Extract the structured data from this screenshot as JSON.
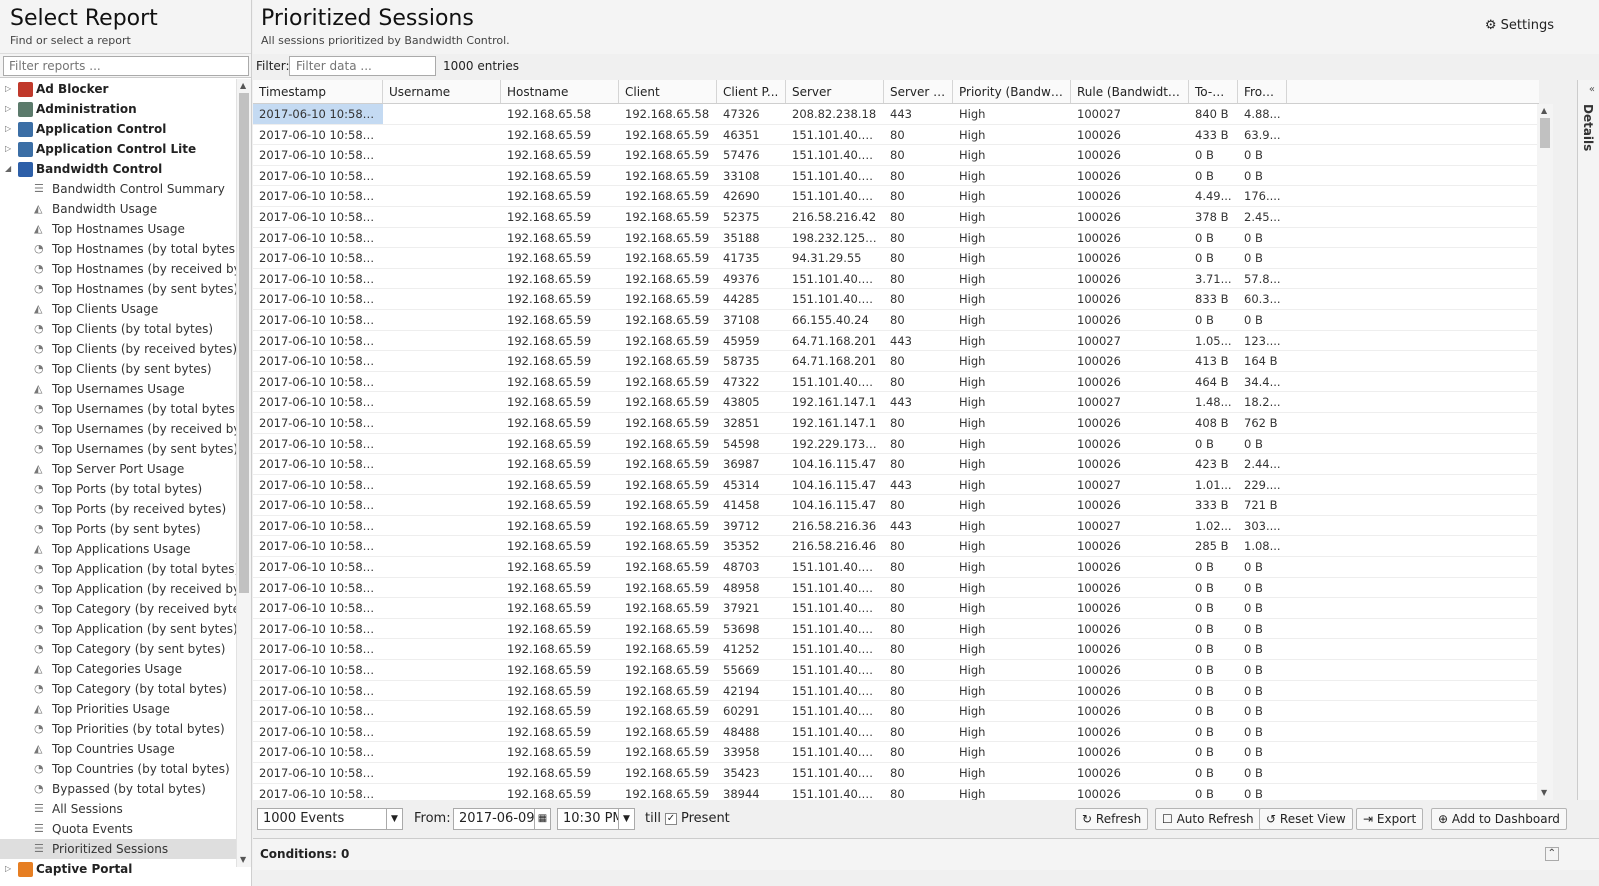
{
  "left": {
    "title": "Select Report",
    "subtitle": "Find or select a report",
    "filter_placeholder": "Filter reports ...",
    "categories": [
      {
        "label": "Ad Blocker",
        "expanded": false,
        "icon_color": "#c0392b"
      },
      {
        "label": "Administration",
        "expanded": false,
        "icon_color": "#5b7a6b"
      },
      {
        "label": "Application Control",
        "expanded": false,
        "icon_color": "#3b6ea5"
      },
      {
        "label": "Application Control Lite",
        "expanded": false,
        "icon_color": "#3b6ea5"
      },
      {
        "label": "Bandwidth Control",
        "expanded": true,
        "icon_color": "#2d5fa8"
      }
    ],
    "reports": [
      {
        "label": "Bandwidth Control Summary",
        "icon": "list-icon"
      },
      {
        "label": "Bandwidth Usage",
        "icon": "area-chart-icon"
      },
      {
        "label": "Top Hostnames Usage",
        "icon": "area-chart-icon"
      },
      {
        "label": "Top Hostnames (by total bytes)",
        "icon": "pie-chart-icon"
      },
      {
        "label": "Top Hostnames (by received byte...",
        "icon": "pie-chart-icon"
      },
      {
        "label": "Top Hostnames (by sent bytes)",
        "icon": "pie-chart-icon"
      },
      {
        "label": "Top Clients Usage",
        "icon": "area-chart-icon"
      },
      {
        "label": "Top Clients (by total bytes)",
        "icon": "pie-chart-icon"
      },
      {
        "label": "Top Clients (by received bytes)",
        "icon": "pie-chart-icon"
      },
      {
        "label": "Top Clients (by sent bytes)",
        "icon": "pie-chart-icon"
      },
      {
        "label": "Top Usernames Usage",
        "icon": "area-chart-icon"
      },
      {
        "label": "Top Usernames (by total bytes)",
        "icon": "pie-chart-icon"
      },
      {
        "label": "Top Usernames (by received bytes)",
        "icon": "pie-chart-icon"
      },
      {
        "label": "Top Usernames (by sent bytes)",
        "icon": "pie-chart-icon"
      },
      {
        "label": "Top Server Port Usage",
        "icon": "area-chart-icon"
      },
      {
        "label": "Top Ports (by total bytes)",
        "icon": "pie-chart-icon"
      },
      {
        "label": "Top Ports (by received bytes)",
        "icon": "pie-chart-icon"
      },
      {
        "label": "Top Ports (by sent bytes)",
        "icon": "pie-chart-icon"
      },
      {
        "label": "Top Applications Usage",
        "icon": "area-chart-icon"
      },
      {
        "label": "Top Application (by total bytes)",
        "icon": "pie-chart-icon"
      },
      {
        "label": "Top Application (by received bytes)",
        "icon": "pie-chart-icon"
      },
      {
        "label": "Top Category (by received bytes)",
        "icon": "pie-chart-icon"
      },
      {
        "label": "Top Application (by sent bytes)",
        "icon": "pie-chart-icon"
      },
      {
        "label": "Top Category (by sent bytes)",
        "icon": "pie-chart-icon"
      },
      {
        "label": "Top Categories Usage",
        "icon": "area-chart-icon"
      },
      {
        "label": "Top Category (by total bytes)",
        "icon": "pie-chart-icon"
      },
      {
        "label": "Top Priorities Usage",
        "icon": "area-chart-icon"
      },
      {
        "label": "Top Priorities (by total bytes)",
        "icon": "pie-chart-icon"
      },
      {
        "label": "Top Countries Usage",
        "icon": "area-chart-icon"
      },
      {
        "label": "Top Countries (by total bytes)",
        "icon": "pie-chart-icon"
      },
      {
        "label": "Bypassed (by total bytes)",
        "icon": "pie-chart-icon"
      },
      {
        "label": "All Sessions",
        "icon": "list-icon"
      },
      {
        "label": "Quota Events",
        "icon": "list-icon"
      },
      {
        "label": "Prioritized Sessions",
        "icon": "list-icon",
        "selected": true
      }
    ],
    "after_category": {
      "label": "Captive Portal",
      "expanded": false,
      "icon_color": "#e67e22"
    }
  },
  "main": {
    "title": "Prioritized Sessions",
    "subtitle": "All sessions prioritized by Bandwidth Control.",
    "settings_label": "Settings",
    "filter_label": "Filter:",
    "filter_placeholder": "Filter data ...",
    "entries_count": "1000 entries",
    "details_label": "Details"
  },
  "grid": {
    "columns": [
      "Timestamp",
      "Username",
      "Hostname",
      "Client",
      "Client P...",
      "Server",
      "Server P...",
      "Priority (Bandwid...",
      "Rule (Bandwidth ...",
      "To-S...",
      "From..."
    ],
    "rows": [
      [
        "2017-06-10 10:58:4...",
        "",
        "192.168.65.58",
        "192.168.65.58",
        "47326",
        "208.82.238.18",
        "443",
        "High",
        "100027",
        "840 B",
        "4.88..."
      ],
      [
        "2017-06-10 10:58:4...",
        "",
        "192.168.65.59",
        "192.168.65.59",
        "46351",
        "151.101.40.1...",
        "80",
        "High",
        "100026",
        "433 B",
        "63.9..."
      ],
      [
        "2017-06-10 10:58:4...",
        "",
        "192.168.65.59",
        "192.168.65.59",
        "57476",
        "151.101.40.1...",
        "80",
        "High",
        "100026",
        "0 B",
        "0 B"
      ],
      [
        "2017-06-10 10:58:4...",
        "",
        "192.168.65.59",
        "192.168.65.59",
        "33108",
        "151.101.40.1...",
        "80",
        "High",
        "100026",
        "0 B",
        "0 B"
      ],
      [
        "2017-06-10 10:58:3...",
        "",
        "192.168.65.59",
        "192.168.65.59",
        "42690",
        "151.101.40.1...",
        "80",
        "High",
        "100026",
        "4.49...",
        "176...."
      ],
      [
        "2017-06-10 10:58:3...",
        "",
        "192.168.65.59",
        "192.168.65.59",
        "52375",
        "216.58.216.42",
        "80",
        "High",
        "100026",
        "378 B",
        "2.45..."
      ],
      [
        "2017-06-10 10:58:3...",
        "",
        "192.168.65.59",
        "192.168.65.59",
        "35188",
        "198.232.125....",
        "80",
        "High",
        "100026",
        "0 B",
        "0 B"
      ],
      [
        "2017-06-10 10:58:3...",
        "",
        "192.168.65.59",
        "192.168.65.59",
        "41735",
        "94.31.29.55",
        "80",
        "High",
        "100026",
        "0 B",
        "0 B"
      ],
      [
        "2017-06-10 10:58:3...",
        "",
        "192.168.65.59",
        "192.168.65.59",
        "49376",
        "151.101.40.1...",
        "80",
        "High",
        "100026",
        "3.71...",
        "57.8..."
      ],
      [
        "2017-06-10 10:58:3...",
        "",
        "192.168.65.59",
        "192.168.65.59",
        "44285",
        "151.101.40.1...",
        "80",
        "High",
        "100026",
        "833 B",
        "60.3..."
      ],
      [
        "2017-06-10 10:58:3...",
        "",
        "192.168.65.59",
        "192.168.65.59",
        "37108",
        "66.155.40.24",
        "80",
        "High",
        "100026",
        "0 B",
        "0 B"
      ],
      [
        "2017-06-10 10:58:3...",
        "",
        "192.168.65.59",
        "192.168.65.59",
        "45959",
        "64.71.168.201",
        "443",
        "High",
        "100027",
        "1.05...",
        "123...."
      ],
      [
        "2017-06-10 10:58:3...",
        "",
        "192.168.65.59",
        "192.168.65.59",
        "58735",
        "64.71.168.201",
        "80",
        "High",
        "100026",
        "413 B",
        "164 B"
      ],
      [
        "2017-06-10 10:58:3...",
        "",
        "192.168.65.59",
        "192.168.65.59",
        "47322",
        "151.101.40.1...",
        "80",
        "High",
        "100026",
        "464 B",
        "34.4..."
      ],
      [
        "2017-06-10 10:58:3...",
        "",
        "192.168.65.59",
        "192.168.65.59",
        "43805",
        "192.161.147.1",
        "443",
        "High",
        "100027",
        "1.48...",
        "18.2..."
      ],
      [
        "2017-06-10 10:58:3...",
        "",
        "192.168.65.59",
        "192.168.65.59",
        "32851",
        "192.161.147.1",
        "80",
        "High",
        "100026",
        "408 B",
        "762 B"
      ],
      [
        "2017-06-10 10:58:3...",
        "",
        "192.168.65.59",
        "192.168.65.59",
        "54598",
        "192.229.173....",
        "80",
        "High",
        "100026",
        "0 B",
        "0 B"
      ],
      [
        "2017-06-10 10:58:3...",
        "",
        "192.168.65.59",
        "192.168.65.59",
        "36987",
        "104.16.115.47",
        "80",
        "High",
        "100026",
        "423 B",
        "2.44..."
      ],
      [
        "2017-06-10 10:58:3...",
        "",
        "192.168.65.59",
        "192.168.65.59",
        "45314",
        "104.16.115.47",
        "443",
        "High",
        "100027",
        "1.01...",
        "229...."
      ],
      [
        "2017-06-10 10:58:3...",
        "",
        "192.168.65.59",
        "192.168.65.59",
        "41458",
        "104.16.115.47",
        "80",
        "High",
        "100026",
        "333 B",
        "721 B"
      ],
      [
        "2017-06-10 10:58:3...",
        "",
        "192.168.65.59",
        "192.168.65.59",
        "39712",
        "216.58.216.36",
        "443",
        "High",
        "100027",
        "1.02...",
        "303...."
      ],
      [
        "2017-06-10 10:58:3...",
        "",
        "192.168.65.59",
        "192.168.65.59",
        "35352",
        "216.58.216.46",
        "80",
        "High",
        "100026",
        "285 B",
        "1.08..."
      ],
      [
        "2017-06-10 10:58:3...",
        "",
        "192.168.65.59",
        "192.168.65.59",
        "48703",
        "151.101.40.1...",
        "80",
        "High",
        "100026",
        "0 B",
        "0 B"
      ],
      [
        "2017-06-10 10:58:3...",
        "",
        "192.168.65.59",
        "192.168.65.59",
        "48958",
        "151.101.40.1...",
        "80",
        "High",
        "100026",
        "0 B",
        "0 B"
      ],
      [
        "2017-06-10 10:58:3...",
        "",
        "192.168.65.59",
        "192.168.65.59",
        "37921",
        "151.101.40.1...",
        "80",
        "High",
        "100026",
        "0 B",
        "0 B"
      ],
      [
        "2017-06-10 10:58:3...",
        "",
        "192.168.65.59",
        "192.168.65.59",
        "53698",
        "151.101.40.1...",
        "80",
        "High",
        "100026",
        "0 B",
        "0 B"
      ],
      [
        "2017-06-10 10:58:3...",
        "",
        "192.168.65.59",
        "192.168.65.59",
        "41252",
        "151.101.40.1...",
        "80",
        "High",
        "100026",
        "0 B",
        "0 B"
      ],
      [
        "2017-06-10 10:58:3...",
        "",
        "192.168.65.59",
        "192.168.65.59",
        "55669",
        "151.101.40.1...",
        "80",
        "High",
        "100026",
        "0 B",
        "0 B"
      ],
      [
        "2017-06-10 10:58:3...",
        "",
        "192.168.65.59",
        "192.168.65.59",
        "42194",
        "151.101.40.1...",
        "80",
        "High",
        "100026",
        "0 B",
        "0 B"
      ],
      [
        "2017-06-10 10:58:3...",
        "",
        "192.168.65.59",
        "192.168.65.59",
        "60291",
        "151.101.40.1...",
        "80",
        "High",
        "100026",
        "0 B",
        "0 B"
      ],
      [
        "2017-06-10 10:58:3...",
        "",
        "192.168.65.59",
        "192.168.65.59",
        "48488",
        "151.101.40.1...",
        "80",
        "High",
        "100026",
        "0 B",
        "0 B"
      ],
      [
        "2017-06-10 10:58:3...",
        "",
        "192.168.65.59",
        "192.168.65.59",
        "33958",
        "151.101.40.1...",
        "80",
        "High",
        "100026",
        "0 B",
        "0 B"
      ],
      [
        "2017-06-10 10:58:3...",
        "",
        "192.168.65.59",
        "192.168.65.59",
        "35423",
        "151.101.40.1...",
        "80",
        "High",
        "100026",
        "0 B",
        "0 B"
      ],
      [
        "2017-06-10 10:58:3...",
        "",
        "192.168.65.59",
        "192.168.65.59",
        "38944",
        "151.101.40.1...",
        "80",
        "High",
        "100026",
        "0 B",
        "0 B"
      ]
    ]
  },
  "toolbar": {
    "events_select": "1000 Events",
    "from_label": "From:",
    "from_date": "2017-06-09",
    "from_time": "10:30 PM",
    "till_label": "till",
    "present_label": "Present",
    "present_checked": true,
    "refresh": "Refresh",
    "auto_refresh": "Auto Refresh",
    "reset_view": "Reset View",
    "export": "Export",
    "add_dashboard": "Add to Dashboard"
  },
  "conditions": {
    "label": "Conditions: 0"
  }
}
